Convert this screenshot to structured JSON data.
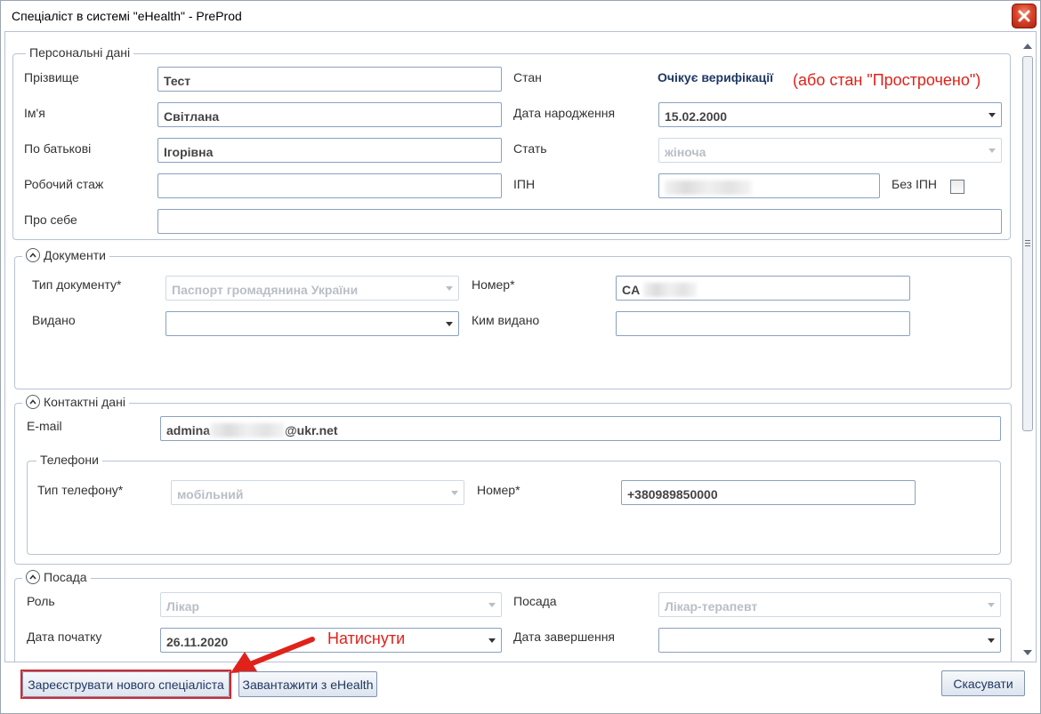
{
  "window": {
    "title": "Спеціаліст в системі \"eHealth\" - PreProd"
  },
  "personal": {
    "legend": "Персональні дані",
    "surname_label": "Прізвище",
    "surname_value": "Тест",
    "name_label": "Ім'я",
    "name_value": "Світлана",
    "patronymic_label": "По батькові",
    "patronymic_value": "Ігорівна",
    "experience_label": "Робочий стаж",
    "experience_value": "",
    "about_label": "Про себе",
    "about_value": "",
    "status_label": "Стан",
    "status_value": "Очікує верифікації",
    "status_note": "(або стан \"Прострочено\")",
    "birthdate_label": "Дата народження",
    "birthdate_value": "15.02.2000",
    "gender_label": "Стать",
    "gender_value": "жіноча",
    "ipn_label": "ІПН",
    "no_ipn_label": "Без ІПН"
  },
  "documents": {
    "legend": "Документи",
    "doc_type_label": "Тип документу*",
    "doc_type_value": "Паспорт громадянина України",
    "issued_label": "Видано",
    "issued_value": "",
    "number_label": "Номер*",
    "number_value": "CA",
    "issued_by_label": "Ким видано",
    "issued_by_value": ""
  },
  "contacts": {
    "legend": "Контактні дані",
    "email_label": "E-mail",
    "email_prefix": "admina",
    "email_suffix": "@ukr.net",
    "phones_legend": "Телефони",
    "phone_type_label": "Тип телефону*",
    "phone_type_value": "мобільний",
    "phone_number_label": "Номер*",
    "phone_number_value": "+380989850000"
  },
  "position": {
    "legend": "Посада",
    "role_label": "Роль",
    "role_value": "Лікар",
    "position_label": "Посада",
    "position_value": "Лікар-терапевт",
    "start_label": "Дата початку",
    "start_value": "26.11.2020",
    "end_label": "Дата завершення",
    "end_value": ""
  },
  "annotation": {
    "click_note": "Натиснути",
    "color": "#e0221a"
  },
  "buttons": {
    "register": "Зареєструвати нового спеціаліста",
    "load": "Завантажити з eHealth",
    "cancel": "Скасувати"
  }
}
